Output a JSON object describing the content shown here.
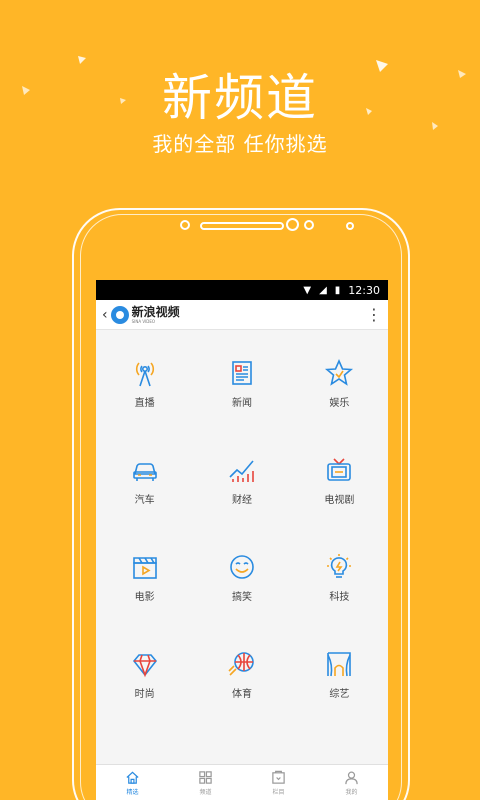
{
  "promo": {
    "headline": "新频道",
    "subline": "我的全部  任你挑选"
  },
  "status_bar": {
    "time": "12:30"
  },
  "app_bar": {
    "back_icon": "chevron-left-icon",
    "logo_title": "新浪视频",
    "logo_subtitle": "SINA VIDEO",
    "menu_icon": "more-vertical-icon"
  },
  "channels": [
    {
      "label": "直播",
      "icon": "antenna-icon"
    },
    {
      "label": "新闻",
      "icon": "newspaper-icon"
    },
    {
      "label": "娱乐",
      "icon": "star-icon"
    },
    {
      "label": "汽车",
      "icon": "car-icon"
    },
    {
      "label": "财经",
      "icon": "stock-chart-icon"
    },
    {
      "label": "电视剧",
      "icon": "tv-icon"
    },
    {
      "label": "电影",
      "icon": "clapperboard-icon"
    },
    {
      "label": "搞笑",
      "icon": "smiley-icon"
    },
    {
      "label": "科技",
      "icon": "lightbulb-icon"
    },
    {
      "label": "时尚",
      "icon": "diamond-icon"
    },
    {
      "label": "体育",
      "icon": "ball-icon"
    },
    {
      "label": "综艺",
      "icon": "stage-icon"
    }
  ],
  "tabs": [
    {
      "label": "精选",
      "icon": "home-icon",
      "active": true
    },
    {
      "label": "频道",
      "icon": "grid-icon",
      "active": false
    },
    {
      "label": "栏目",
      "icon": "column-icon",
      "active": false
    },
    {
      "label": "我的",
      "icon": "user-icon",
      "active": false
    }
  ],
  "colors": {
    "background": "#FFB627",
    "icon_blue": "#2A8BE0",
    "icon_orange": "#F5A623",
    "icon_red": "#E8453C"
  }
}
